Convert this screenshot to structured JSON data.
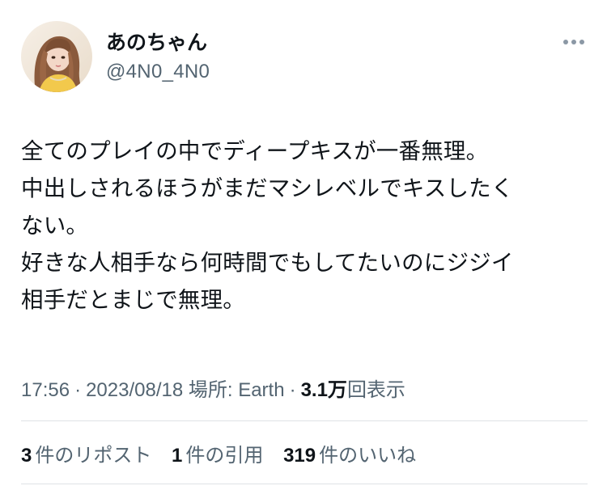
{
  "user": {
    "display_name": "あのちゃん",
    "handle": "@4N0_4N0"
  },
  "more_icon": "more-horizontal-icon",
  "tweet": {
    "lines": [
      "全てのプレイの中でディープキスが一番無理。",
      "中出しされるほうがまだマシレベルでキスしたく",
      "ない。",
      "好きな人相手なら何時間でもしてたいのにジジイ",
      "相手だとまじで無理。"
    ]
  },
  "meta": {
    "time": "17:56",
    "separator": "·",
    "date": "2023/08/18",
    "location_label": "場所: Earth",
    "views_count": "3.1万",
    "views_label": "回表示"
  },
  "stats": {
    "reposts_count": "3",
    "reposts_label": "件のリポスト",
    "quotes_count": "1",
    "quotes_label": "件の引用",
    "likes_count": "319",
    "likes_label": "件のいいね"
  },
  "colors": {
    "text_primary": "#0f1419",
    "text_secondary": "#536471",
    "divider": "#dfe3e6"
  }
}
